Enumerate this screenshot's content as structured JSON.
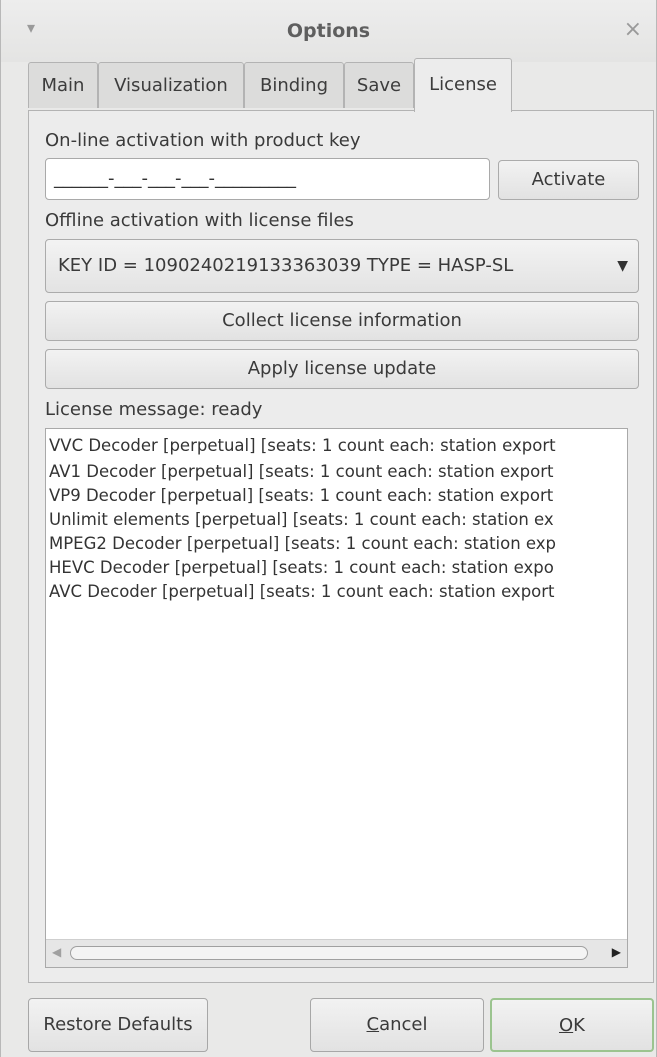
{
  "window": {
    "title": "Options",
    "menu_icon": "triangle-down-icon",
    "close_icon": "close-icon",
    "close_glyph": "×",
    "menu_glyph": "▾"
  },
  "tabs": [
    {
      "label": "Main",
      "active": false
    },
    {
      "label": "Visualization",
      "active": false
    },
    {
      "label": "Binding",
      "active": false
    },
    {
      "label": "Save",
      "active": false
    },
    {
      "label": "License",
      "active": true
    }
  ],
  "license": {
    "online_label": "On-line activation with product key",
    "product_key_value": "______-___-___-___-_________",
    "activate_label": "Activate",
    "offline_label": "Offline activation with license files",
    "license_file_selected": "KEY ID = 1090240219133363039 TYPE = HASP-SL",
    "collect_label": "Collect license information",
    "apply_label": "Apply license update",
    "message_label": "License message: ready",
    "items": [
      "VVC Decoder [perpetual] [seats: 1 count each: station export",
      "AV1 Decoder [perpetual] [seats: 1 count each: station export",
      "VP9 Decoder [perpetual] [seats: 1 count each: station export",
      "Unlimit elements [perpetual] [seats: 1 count each: station ex",
      "MPEG2 Decoder [perpetual] [seats: 1 count each: station exp",
      "HEVC Decoder [perpetual] [seats: 1 count each: station expo",
      "AVC Decoder [perpetual] [seats: 1 count each: station export"
    ]
  },
  "footer": {
    "restore_label": "Restore Defaults",
    "cancel_mnemonic": "C",
    "cancel_rest": "ancel",
    "ok_mnemonic": "O",
    "ok_rest": "K"
  },
  "colors": {
    "ok_border": "#9bc48f",
    "background": "#e9e9e8"
  }
}
